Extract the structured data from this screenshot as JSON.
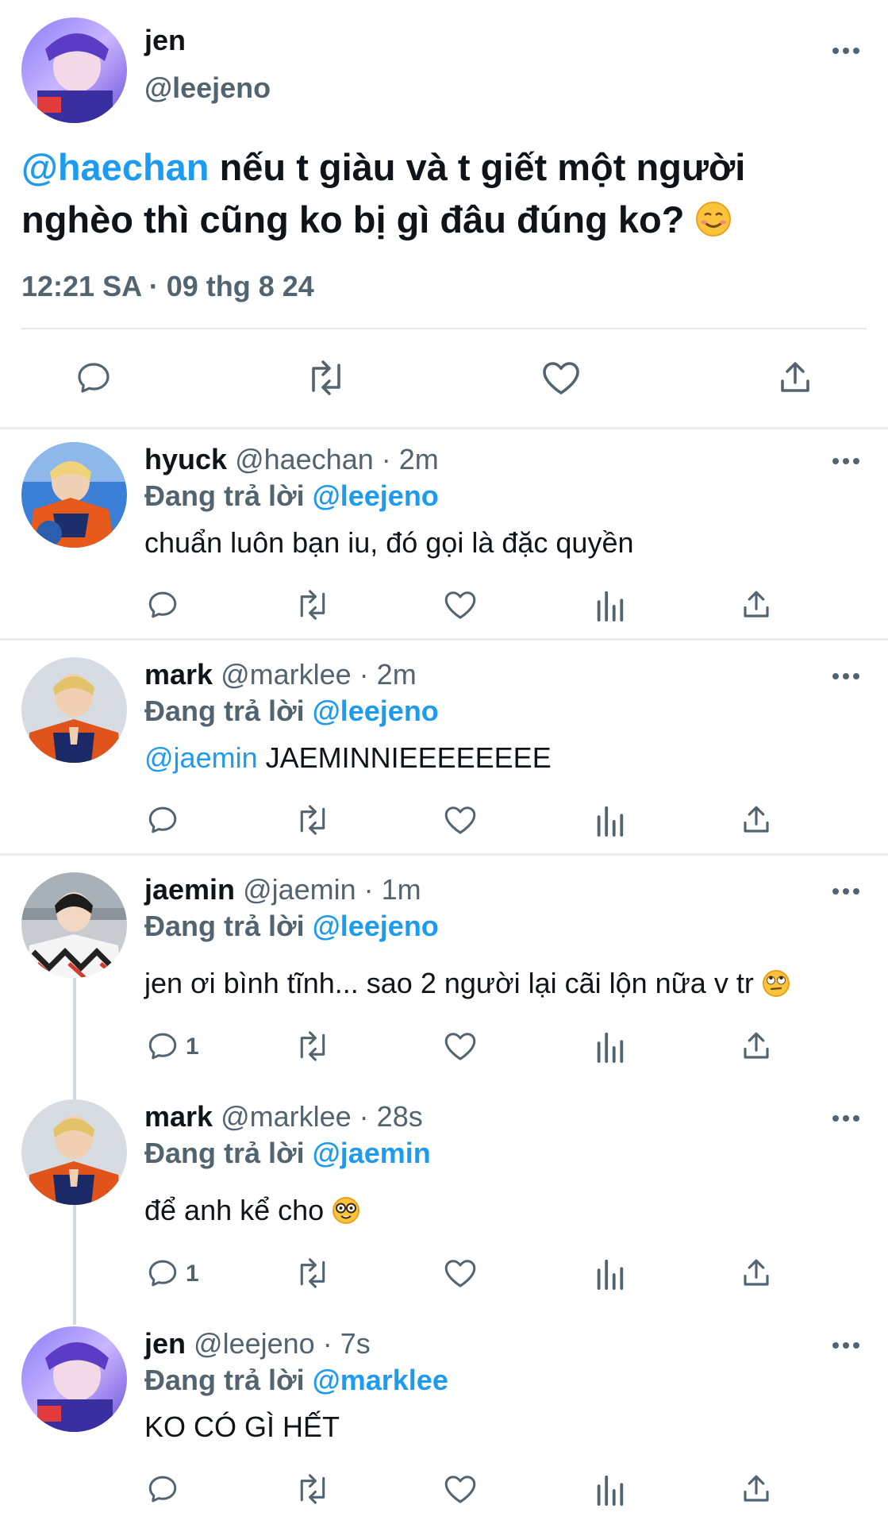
{
  "main_tweet": {
    "name": "jen",
    "handle": "@leejeno",
    "mention": "@haechan",
    "text": " nếu t giàu và t giết một người nghèo thì cũng ko bị gì đâu đúng ko?",
    "emoji": "smiling-face-emoji",
    "timestamp": "12:21 SA · 09 thg 8 24"
  },
  "replies": [
    {
      "name": "hyuck",
      "handle": "@haechan",
      "time": "2m",
      "replying_prefix": "Đang trả lời",
      "replying_to": "@leejeno",
      "mention": "",
      "text": "chuẩn luôn bạn iu, đó gọi là đặc quyền",
      "emoji": "",
      "reply_count": ""
    },
    {
      "name": "mark",
      "handle": "@marklee",
      "time": "2m",
      "replying_prefix": "Đang trả lời",
      "replying_to": "@leejeno",
      "mention": "@jaemin",
      "text": " JAEMINNIEEEEEEEE",
      "emoji": "",
      "reply_count": ""
    },
    {
      "name": "jaemin",
      "handle": "@jaemin",
      "time": "1m",
      "replying_prefix": "Đang trả lời",
      "replying_to": "@leejeno",
      "mention": "",
      "text": "jen ơi bình tĩnh... sao 2 người lại cãi lộn nữa v tr",
      "emoji": "rolling-eyes-emoji",
      "reply_count": "1"
    },
    {
      "name": "mark",
      "handle": "@marklee",
      "time": "28s",
      "replying_prefix": "Đang trả lời",
      "replying_to": "@jaemin",
      "mention": "",
      "text": "để anh kể cho",
      "emoji": "nerd-face-emoji",
      "reply_count": "1"
    },
    {
      "name": "jen",
      "handle": "@leejeno",
      "time": "7s",
      "replying_prefix": "Đang trả lời",
      "replying_to": "@marklee",
      "mention": "",
      "text": "KO CÓ GÌ HẾT",
      "emoji": "",
      "reply_count": ""
    }
  ],
  "separator": " · ",
  "icons": [
    "reply-icon",
    "retweet-icon",
    "like-icon",
    "views-icon",
    "share-icon",
    "more-icon"
  ],
  "colors": {
    "accent": "#1d9bf0",
    "secondary_text": "#536471",
    "divider": "#ececec"
  }
}
